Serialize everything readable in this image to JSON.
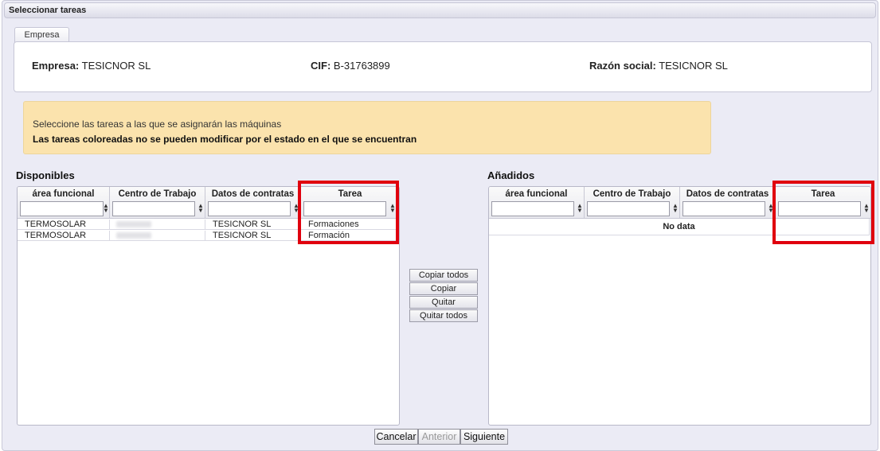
{
  "dialog": {
    "title": "Seleccionar tareas"
  },
  "tabs": [
    {
      "label": "Empresa"
    }
  ],
  "empresa": {
    "empresa_label": "Empresa:",
    "empresa_value": "TESICNOR SL",
    "cif_label": "CIF:",
    "cif_value": "B-31763899",
    "razon_label": "Razón social:",
    "razon_value": "TESICNOR SL"
  },
  "notice": {
    "line1": "Seleccione las tareas a las que se asignarán las máquinas",
    "line2": "Las tareas coloreadas no se pueden modificar por el estado en el que se encuentran",
    "background_color": "#fbe3ad"
  },
  "disponibles": {
    "title": "Disponibles",
    "columns": [
      "área funcional",
      "Centro de Trabajo",
      "Datos de contratas",
      "Tarea"
    ],
    "rows": [
      {
        "area": "TERMOSOLAR",
        "centro": "",
        "datos": "TESICNOR SL",
        "tarea": "Formaciones"
      },
      {
        "area": "TERMOSOLAR",
        "centro": "",
        "datos": "TESICNOR SL",
        "tarea": "Formación"
      }
    ]
  },
  "anadidos": {
    "title": "Añadidos",
    "columns": [
      "área funcional",
      "Centro de Trabajo",
      "Datos de contratas",
      "Tarea"
    ],
    "empty_text": "No data"
  },
  "transfer_buttons": {
    "copy_all": "Copiar todos",
    "copy": "Copiar",
    "remove": "Quitar",
    "remove_all": "Quitar todos"
  },
  "footer": {
    "cancel": "Cancelar",
    "previous": "Anterior",
    "next": "Siguiente"
  },
  "highlight_color": "#e0000e"
}
